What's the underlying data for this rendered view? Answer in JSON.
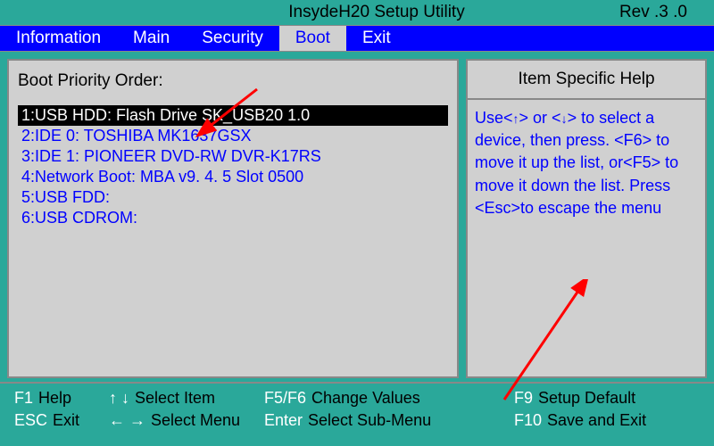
{
  "header": {
    "title": "InsydeH20  Setup  Utility",
    "revision": "Rev .3 .0"
  },
  "menu": {
    "items": [
      "Information",
      "Main",
      "Security",
      "Boot",
      "Exit"
    ],
    "active_index": 3
  },
  "boot": {
    "title": "Boot Priority Order:",
    "items": [
      "1:USB HDD:  Flash Drive  SK_USB20  1.0",
      "2:IDE 0: TOSHIBA MK1637GSX",
      "3:IDE 1: PIONEER DVD-RW  DVR-K17RS",
      "4:Network Boot:  MBA  v9. 4. 5  Slot  0500",
      "5:USB FDD:",
      "6:USB CDROM:"
    ],
    "selected_index": 0
  },
  "help": {
    "header": "Item Specific Help",
    "body_pre": "Use<",
    "body_arrow_up": "↑",
    "body_mid1": "> or <",
    "body_arrow_down": "↓",
    "body_post": "> to select a device,  then press. <F6> to move it up the list, or<F5> to move it down the list. Press <Esc>to escape the menu"
  },
  "footer": {
    "row1": [
      {
        "key": "F1",
        "label": "Help"
      },
      {
        "arrows": "↑ ↓",
        "label": "Select Item"
      },
      {
        "key": "F5/F6",
        "label": "Change Values"
      },
      {
        "key": "F9",
        "label": "Setup Default"
      }
    ],
    "row2": [
      {
        "key": "ESC",
        "label": "Exit"
      },
      {
        "arrows": "← →",
        "label": "Select Menu"
      },
      {
        "key": "Enter",
        "label": "Select   Sub-Menu"
      },
      {
        "key": "F10",
        "label": "Save and Exit"
      }
    ]
  }
}
